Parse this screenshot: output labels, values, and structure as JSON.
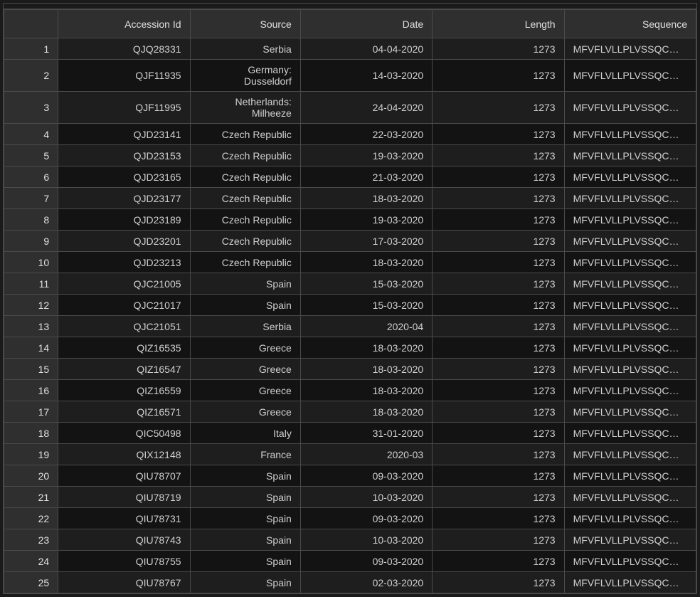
{
  "table": {
    "headers": {
      "row_num": "",
      "accession_id": "Accession Id",
      "source": "Source",
      "date": "Date",
      "length": "Length",
      "sequence": "Sequence"
    },
    "rows": [
      {
        "num": "1",
        "accession_id": "QJQ28331",
        "source": "Serbia",
        "date": "04-04-2020",
        "length": "1273",
        "sequence": "MFVFLVLLPLVSSQC…"
      },
      {
        "num": "2",
        "accession_id": "QJF11935",
        "source": "Germany: Dusseldorf",
        "date": "14-03-2020",
        "length": "1273",
        "sequence": "MFVFLVLLPLVSSQC…"
      },
      {
        "num": "3",
        "accession_id": "QJF11995",
        "source": "Netherlands: Milheeze",
        "date": "24-04-2020",
        "length": "1273",
        "sequence": "MFVFLVLLPLVSSQC…"
      },
      {
        "num": "4",
        "accession_id": "QJD23141",
        "source": "Czech Republic",
        "date": "22-03-2020",
        "length": "1273",
        "sequence": "MFVFLVLLPLVSSQC…"
      },
      {
        "num": "5",
        "accession_id": "QJD23153",
        "source": "Czech Republic",
        "date": "19-03-2020",
        "length": "1273",
        "sequence": "MFVFLVLLPLVSSQC…"
      },
      {
        "num": "6",
        "accession_id": "QJD23165",
        "source": "Czech Republic",
        "date": "21-03-2020",
        "length": "1273",
        "sequence": "MFVFLVLLPLVSSQC…"
      },
      {
        "num": "7",
        "accession_id": "QJD23177",
        "source": "Czech Republic",
        "date": "18-03-2020",
        "length": "1273",
        "sequence": "MFVFLVLLPLVSSQC…"
      },
      {
        "num": "8",
        "accession_id": "QJD23189",
        "source": "Czech Republic",
        "date": "19-03-2020",
        "length": "1273",
        "sequence": "MFVFLVLLPLVSSQC…"
      },
      {
        "num": "9",
        "accession_id": "QJD23201",
        "source": "Czech Republic",
        "date": "17-03-2020",
        "length": "1273",
        "sequence": "MFVFLVLLPLVSSQC…"
      },
      {
        "num": "10",
        "accession_id": "QJD23213",
        "source": "Czech Republic",
        "date": "18-03-2020",
        "length": "1273",
        "sequence": "MFVFLVLLPLVSSQC…"
      },
      {
        "num": "11",
        "accession_id": "QJC21005",
        "source": "Spain",
        "date": "15-03-2020",
        "length": "1273",
        "sequence": "MFVFLVLLPLVSSQC…"
      },
      {
        "num": "12",
        "accession_id": "QJC21017",
        "source": "Spain",
        "date": "15-03-2020",
        "length": "1273",
        "sequence": "MFVFLVLLPLVSSQC…"
      },
      {
        "num": "13",
        "accession_id": "QJC21051",
        "source": "Serbia",
        "date": "2020-04",
        "length": "1273",
        "sequence": "MFVFLVLLPLVSSQC…"
      },
      {
        "num": "14",
        "accession_id": "QIZ16535",
        "source": "Greece",
        "date": "18-03-2020",
        "length": "1273",
        "sequence": "MFVFLVLLPLVSSQC…"
      },
      {
        "num": "15",
        "accession_id": "QIZ16547",
        "source": "Greece",
        "date": "18-03-2020",
        "length": "1273",
        "sequence": "MFVFLVLLPLVSSQC…"
      },
      {
        "num": "16",
        "accession_id": "QIZ16559",
        "source": "Greece",
        "date": "18-03-2020",
        "length": "1273",
        "sequence": "MFVFLVLLPLVSSQC…"
      },
      {
        "num": "17",
        "accession_id": "QIZ16571",
        "source": "Greece",
        "date": "18-03-2020",
        "length": "1273",
        "sequence": "MFVFLVLLPLVSSQC…"
      },
      {
        "num": "18",
        "accession_id": "QIC50498",
        "source": "Italy",
        "date": "31-01-2020",
        "length": "1273",
        "sequence": "MFVFLVLLPLVSSQC…"
      },
      {
        "num": "19",
        "accession_id": "QIX12148",
        "source": "France",
        "date": "2020-03",
        "length": "1273",
        "sequence": "MFVFLVLLPLVSSQC…"
      },
      {
        "num": "20",
        "accession_id": "QIU78707",
        "source": "Spain",
        "date": "09-03-2020",
        "length": "1273",
        "sequence": "MFVFLVLLPLVSSQC…"
      },
      {
        "num": "21",
        "accession_id": "QIU78719",
        "source": "Spain",
        "date": "10-03-2020",
        "length": "1273",
        "sequence": "MFVFLVLLPLVSSQC…"
      },
      {
        "num": "22",
        "accession_id": "QIU78731",
        "source": "Spain",
        "date": "09-03-2020",
        "length": "1273",
        "sequence": "MFVFLVLLPLVSSQC…"
      },
      {
        "num": "23",
        "accession_id": "QIU78743",
        "source": "Spain",
        "date": "10-03-2020",
        "length": "1273",
        "sequence": "MFVFLVLLPLVSSQC…"
      },
      {
        "num": "24",
        "accession_id": "QIU78755",
        "source": "Spain",
        "date": "09-03-2020",
        "length": "1273",
        "sequence": "MFVFLVLLPLVSSQC…"
      },
      {
        "num": "25",
        "accession_id": "QIU78767",
        "source": "Spain",
        "date": "02-03-2020",
        "length": "1273",
        "sequence": "MFVFLVLLPLVSSQC…"
      }
    ]
  }
}
